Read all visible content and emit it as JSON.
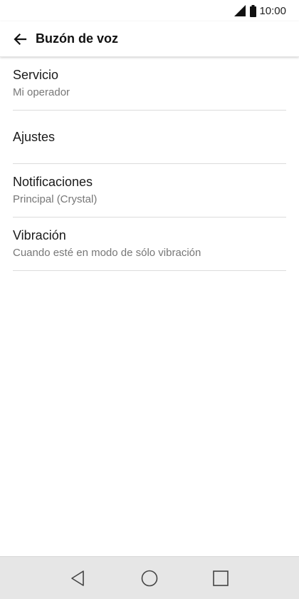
{
  "status_bar": {
    "time": "10:00",
    "icons": [
      "signal-icon",
      "battery-icon"
    ]
  },
  "app_bar": {
    "title": "Buzón de voz",
    "back_icon": "arrow-left-icon"
  },
  "settings": [
    {
      "title": "Servicio",
      "subtitle": "Mi operador"
    },
    {
      "title": "Ajustes",
      "subtitle": ""
    },
    {
      "title": "Notificaciones",
      "subtitle": "Principal (Crystal)"
    },
    {
      "title": "Vibración",
      "subtitle": "Cuando esté en modo de sólo vibración"
    }
  ],
  "nav_bar": {
    "buttons": [
      "back-triangle-icon",
      "home-circle-icon",
      "recents-square-icon"
    ]
  },
  "colors": {
    "nav_background": "#e6e6e6",
    "subtitle": "#777777",
    "divider": "#dcdcdc"
  }
}
